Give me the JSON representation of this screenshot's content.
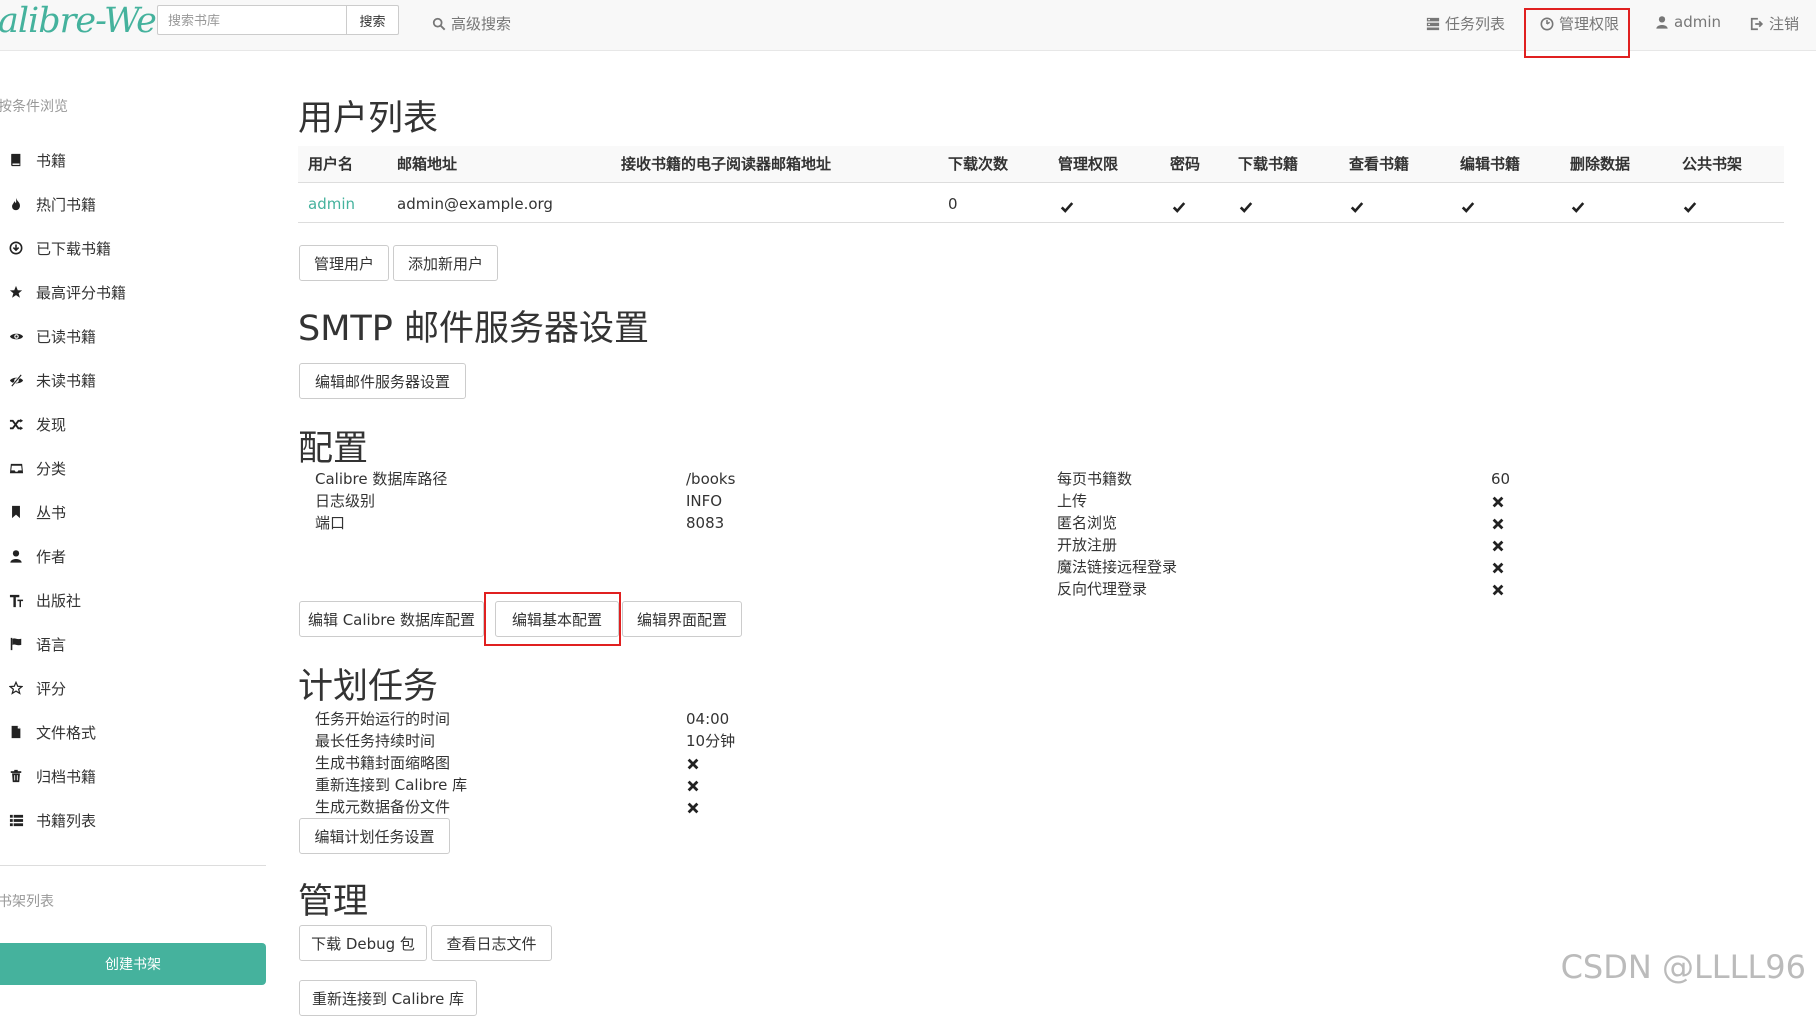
{
  "navbar": {
    "brand": "alibre-Web",
    "search_placeholder": "搜索书库",
    "search_button": "搜索",
    "advanced_search": "高级搜索",
    "tasks": "任务列表",
    "admin_rights": "管理权限",
    "user": "admin",
    "logout": "注销"
  },
  "sidebar": {
    "browse_header": "按条件浏览",
    "items": [
      {
        "label": "书籍",
        "icon": "book-icon"
      },
      {
        "label": "热门书籍",
        "icon": "fire-icon"
      },
      {
        "label": "已下载书籍",
        "icon": "download-icon"
      },
      {
        "label": "最高评分书籍",
        "icon": "star-icon"
      },
      {
        "label": "已读书籍",
        "icon": "eye-open-icon"
      },
      {
        "label": "未读书籍",
        "icon": "eye-close-icon"
      },
      {
        "label": "发现",
        "icon": "random-icon"
      },
      {
        "label": "分类",
        "icon": "inbox-icon"
      },
      {
        "label": "丛书",
        "icon": "bookmark-icon"
      },
      {
        "label": "作者",
        "icon": "user-icon"
      },
      {
        "label": "出版社",
        "icon": "text-size-icon"
      },
      {
        "label": "语言",
        "icon": "flag-icon"
      },
      {
        "label": "评分",
        "icon": "star-empty-icon"
      },
      {
        "label": "文件格式",
        "icon": "file-icon"
      },
      {
        "label": "归档书籍",
        "icon": "trash-icon"
      },
      {
        "label": "书籍列表",
        "icon": "list-icon"
      }
    ],
    "shelves_header": "书架列表",
    "create_shelf": "创建书架"
  },
  "users": {
    "title": "用户列表",
    "columns": [
      "用户名",
      "邮箱地址",
      "接收书籍的电子阅读器邮箱地址",
      "下载次数",
      "管理权限",
      "密码",
      "下载书籍",
      "查看书籍",
      "编辑书籍",
      "删除数据",
      "公共书架"
    ],
    "rows": [
      {
        "username": "admin",
        "email": "admin@example.org",
        "kindle": "",
        "downloads": "0",
        "flags": [
          true,
          true,
          true,
          true,
          true,
          true,
          true
        ]
      }
    ],
    "manage_button": "管理用户",
    "add_button": "添加新用户"
  },
  "smtp": {
    "title": "SMTP 邮件服务器设置",
    "edit_button": "编辑邮件服务器设置"
  },
  "config": {
    "title": "配置",
    "left": [
      {
        "label": "Calibre 数据库路径",
        "value": "/books"
      },
      {
        "label": "日志级别",
        "value": "INFO"
      },
      {
        "label": "端口",
        "value": "8083"
      }
    ],
    "right": [
      {
        "label": "每页书籍数",
        "value": "60"
      },
      {
        "label": "上传",
        "value": false
      },
      {
        "label": "匿名浏览",
        "value": false
      },
      {
        "label": "开放注册",
        "value": false
      },
      {
        "label": "魔法链接远程登录",
        "value": false
      },
      {
        "label": "反向代理登录",
        "value": false
      }
    ],
    "buttons": [
      "编辑 Calibre 数据库配置",
      "编辑基本配置",
      "编辑界面配置"
    ]
  },
  "scheduled": {
    "title": "计划任务",
    "rows": [
      {
        "label": "任务开始运行的时间",
        "value": "04:00"
      },
      {
        "label": "最长任务持续时间",
        "value": "10分钟"
      },
      {
        "label": "生成书籍封面缩略图",
        "value": false
      },
      {
        "label": "重新连接到 Calibre 库",
        "value": false
      },
      {
        "label": "生成元数据备份文件",
        "value": false
      }
    ],
    "edit_button": "编辑计划任务设置"
  },
  "admin": {
    "title": "管理",
    "debug_button": "下载 Debug 包",
    "logs_button": "查看日志文件",
    "reconnect_button": "重新连接到 Calibre 库"
  },
  "watermark": "CSDN @LLLL96",
  "colors": {
    "accent": "#45b29d",
    "highlight": "#e02020"
  }
}
